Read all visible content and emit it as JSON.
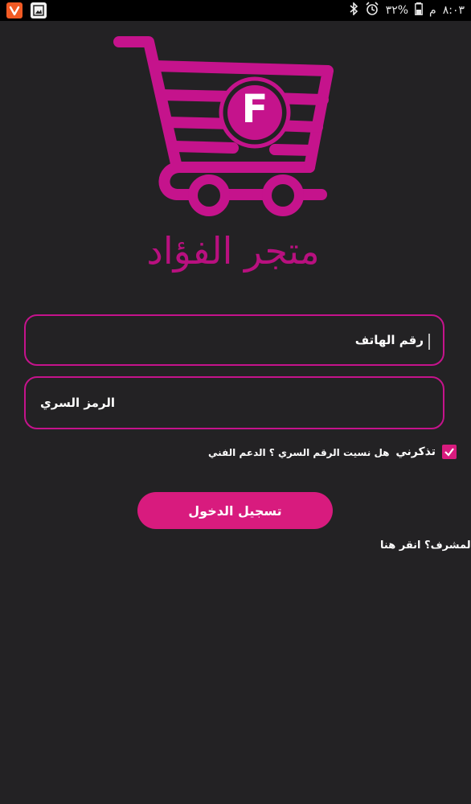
{
  "status_bar": {
    "time": "٨:٠٣",
    "period": "م",
    "battery": "٣٢%",
    "icons": [
      "vivaldi-icon",
      "gallery-icon",
      "bluetooth-icon",
      "alarm-icon",
      "battery-icon"
    ]
  },
  "logo": {
    "letter": "F",
    "store_name": "متجر الفؤاد",
    "color": "#c5138c"
  },
  "login_form": {
    "phone_placeholder": "رقم الهاتف",
    "password_placeholder": "الرمز السري",
    "remember_label": "تذكرني",
    "forgot_label": "هل نسيت الرقم السري ؟ الدعم الفني",
    "login_button": "تسجيل الدخول",
    "admin_link": "المشرف؟ انقر هنا"
  },
  "colors": {
    "accent": "#d81b7e",
    "border": "#c5138c",
    "background": "#232224"
  }
}
